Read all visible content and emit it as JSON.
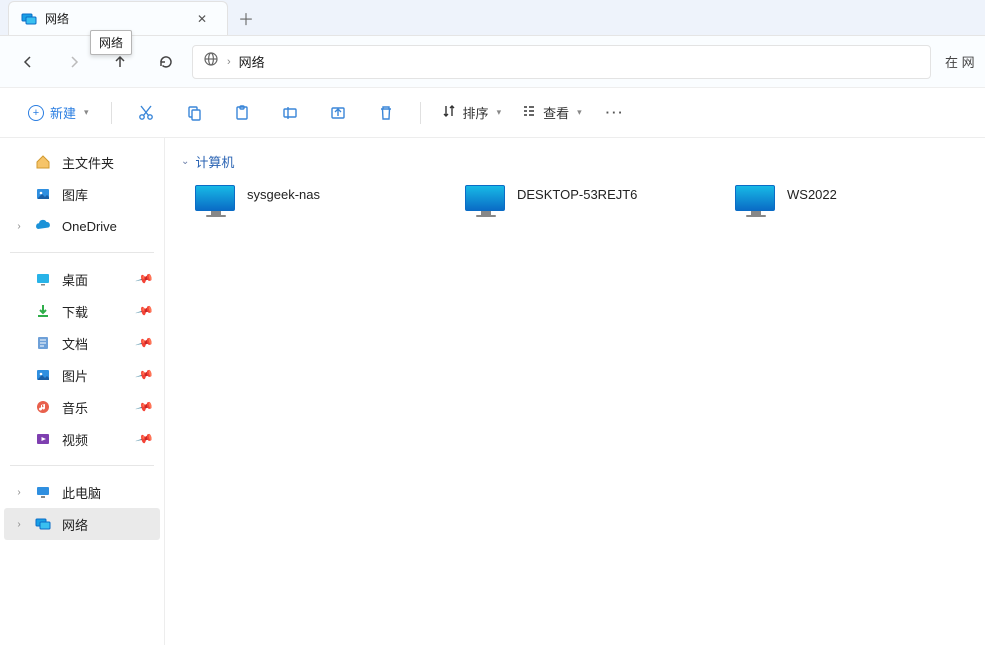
{
  "tab": {
    "title": "网络",
    "tooltip": "网络"
  },
  "address": {
    "crumb": "网络"
  },
  "search": {
    "hint": "在 网"
  },
  "toolbar": {
    "new_label": "新建",
    "sort_label": "排序",
    "view_label": "查看"
  },
  "sidebar": {
    "home": "主文件夹",
    "gallery": "图库",
    "onedrive": "OneDrive",
    "quick": [
      {
        "key": "desktop",
        "label": "桌面"
      },
      {
        "key": "downloads",
        "label": "下载"
      },
      {
        "key": "documents",
        "label": "文档"
      },
      {
        "key": "pictures",
        "label": "图片"
      },
      {
        "key": "music",
        "label": "音乐"
      },
      {
        "key": "videos",
        "label": "视频"
      }
    ],
    "this_pc": "此电脑",
    "network": "网络"
  },
  "group": {
    "header": "计算机"
  },
  "computers": [
    {
      "name": "sysgeek-nas"
    },
    {
      "name": "DESKTOP-53REJT6"
    },
    {
      "name": "WS2022"
    }
  ]
}
